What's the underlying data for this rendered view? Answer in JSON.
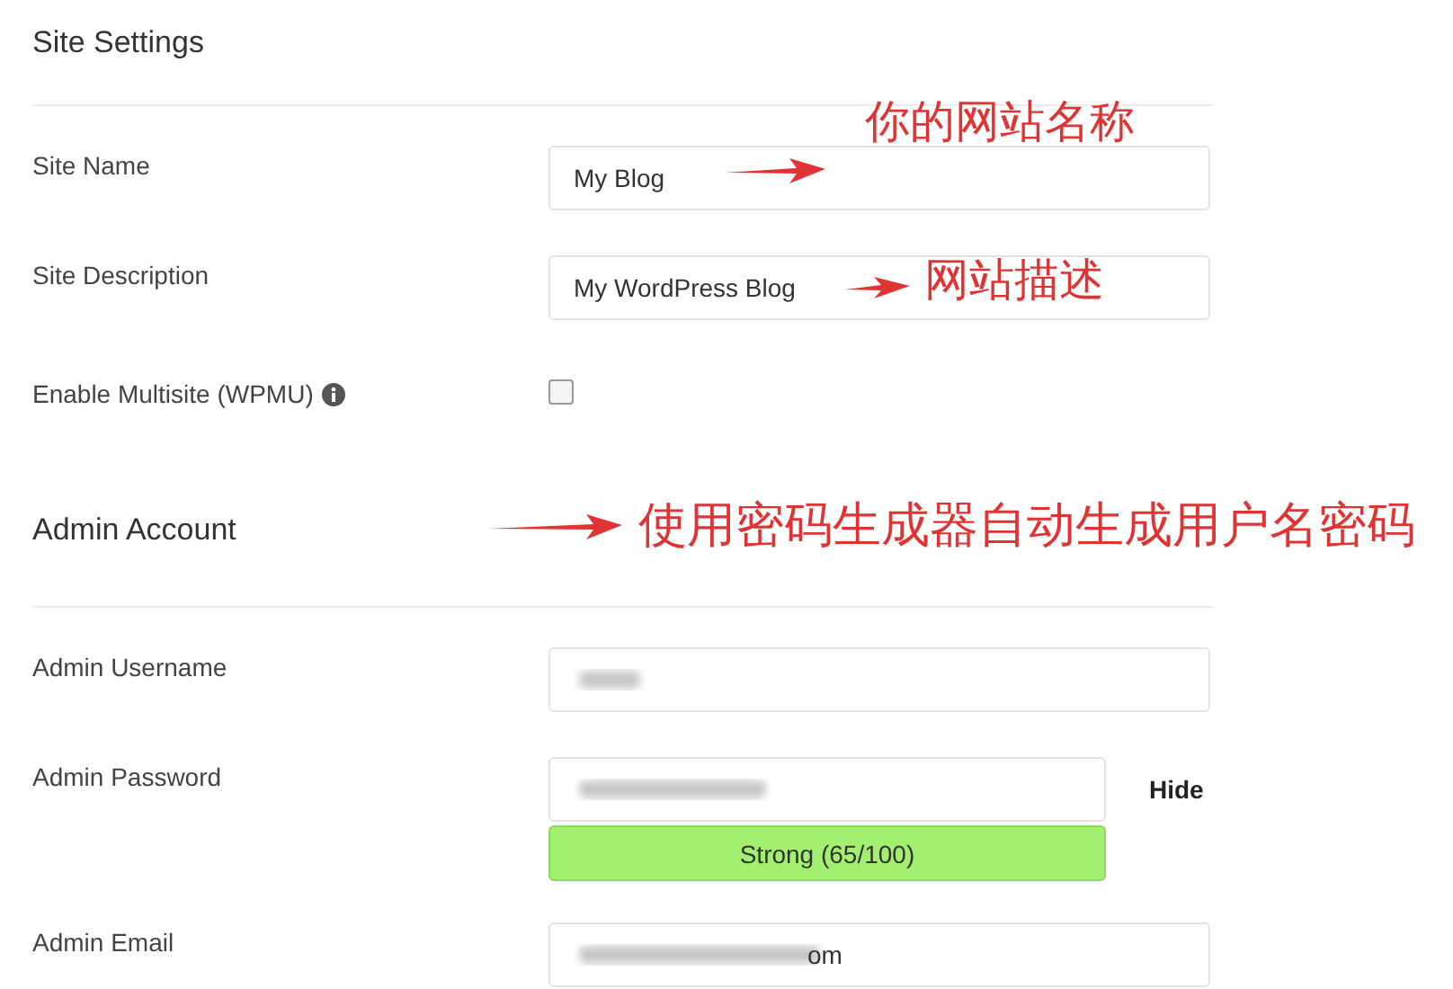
{
  "site_settings": {
    "title": "Site Settings",
    "fields": [
      {
        "kind": "text",
        "label": "Site Name",
        "value": "My Blog"
      },
      {
        "kind": "text",
        "label": "Site Description",
        "value": "My WordPress Blog"
      },
      {
        "kind": "checkbox",
        "label": "Enable Multisite (WPMU)",
        "checked": false,
        "info": true
      }
    ]
  },
  "admin_account": {
    "title": "Admin Account",
    "fields": [
      {
        "kind": "redacted",
        "label": "Admin Username"
      },
      {
        "kind": "password",
        "label": "Admin Password",
        "toggle": "Hide",
        "strength": {
          "label": "Strong (65/100)"
        }
      },
      {
        "kind": "redacted",
        "label": "Admin Email",
        "value": "om"
      }
    ]
  },
  "annotations": [
    {
      "text": "你的网站名称"
    },
    {
      "text": "网站描述"
    },
    {
      "text": "使用密码生成器自动生成用户名密码"
    }
  ]
}
